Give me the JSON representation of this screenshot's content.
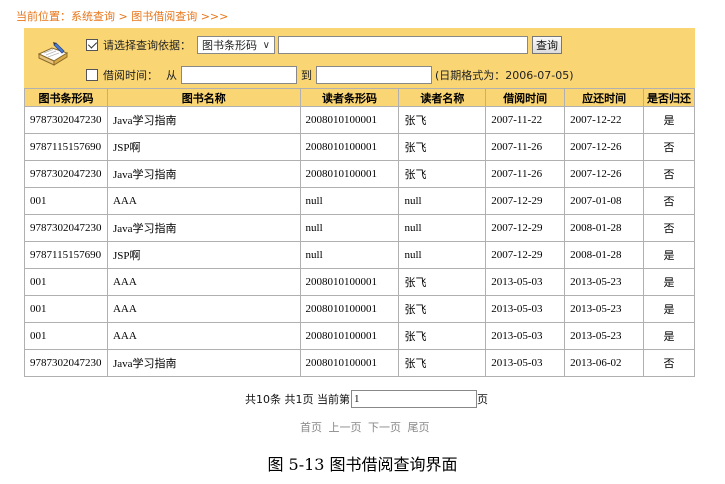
{
  "breadcrumb": "当前位置：系统查询 > 图书借阅查询 >>>",
  "search": {
    "criteria_checked": true,
    "criteria_label": "请选择查询依据：",
    "field_select": "图书条形码",
    "keyword_value": "",
    "query_button": "查询",
    "date_checked": false,
    "date_label": "借阅时间：",
    "from_label": "从",
    "from_value": "",
    "to_label": "到",
    "to_value": "",
    "date_hint": "(日期格式为：2006-07-05)"
  },
  "table": {
    "headers": [
      "图书条形码",
      "图书名称",
      "读者条形码",
      "读者名称",
      "借阅时间",
      "应还时间",
      "是否归还"
    ],
    "rows": [
      [
        "9787302047230",
        "Java学习指南",
        "2008010100001",
        "张飞",
        "2007-11-22",
        "2007-12-22",
        "是"
      ],
      [
        "9787115157690",
        "JSP啊",
        "2008010100001",
        "张飞",
        "2007-11-26",
        "2007-12-26",
        "否"
      ],
      [
        "9787302047230",
        "Java学习指南",
        "2008010100001",
        "张飞",
        "2007-11-26",
        "2007-12-26",
        "否"
      ],
      [
        "001",
        "AAA",
        "null",
        "null",
        "2007-12-29",
        "2007-01-08",
        "否"
      ],
      [
        "9787302047230",
        "Java学习指南",
        "null",
        "null",
        "2007-12-29",
        "2008-01-28",
        "否"
      ],
      [
        "9787115157690",
        "JSP啊",
        "null",
        "null",
        "2007-12-29",
        "2008-01-28",
        "是"
      ],
      [
        "001",
        "AAA",
        "2008010100001",
        "张飞",
        "2013-05-03",
        "2013-05-23",
        "是"
      ],
      [
        "001",
        "AAA",
        "2008010100001",
        "张飞",
        "2013-05-03",
        "2013-05-23",
        "是"
      ],
      [
        "001",
        "AAA",
        "2008010100001",
        "张飞",
        "2013-05-03",
        "2013-05-23",
        "是"
      ],
      [
        "9787302047230",
        "Java学习指南",
        "2008010100001",
        "张飞",
        "2013-05-03",
        "2013-06-02",
        "否"
      ]
    ]
  },
  "pager": {
    "summary": "共10条 共1页 当前第",
    "page_value": "1",
    "page_suffix": "页",
    "links": [
      "首页",
      "上一页",
      "下一页",
      "尾页"
    ]
  },
  "caption": "图 5-13  图书借阅查询界面",
  "colors": {
    "panel": "#f9d574",
    "breadcrumb": "#e8761a",
    "border": "#b0b0b0"
  },
  "icons": {
    "panel": "book-pen-icon"
  }
}
